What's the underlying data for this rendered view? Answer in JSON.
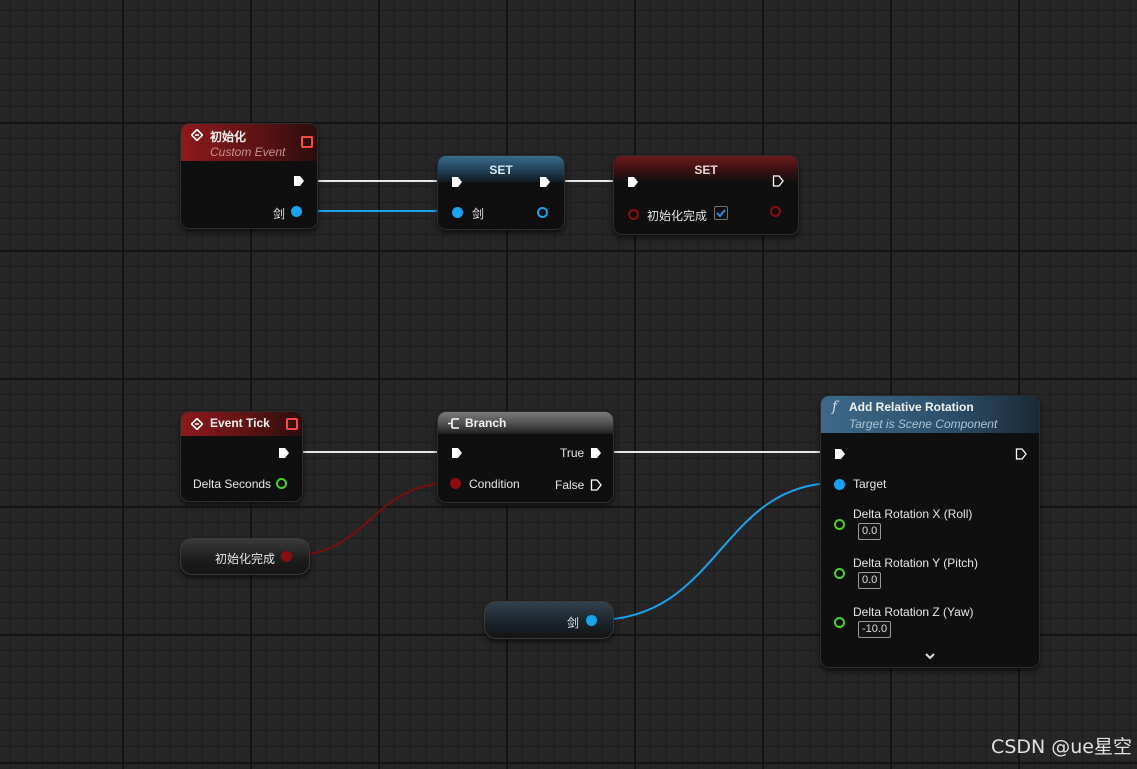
{
  "nodes": {
    "custom_event": {
      "title": "初始化",
      "subtitle": "Custom Event",
      "pin_label": "剑"
    },
    "set_sword": {
      "title": "SET",
      "pin_label": "剑"
    },
    "set_init": {
      "title": "SET",
      "pin_label": "初始化完成",
      "checked": true
    },
    "event_tick": {
      "title": "Event Tick",
      "pin_label": "Delta Seconds"
    },
    "branch": {
      "title": "Branch",
      "condition_label": "Condition",
      "true_label": "True",
      "false_label": "False"
    },
    "get_init": {
      "label": "初始化完成"
    },
    "get_sword": {
      "label": "剑"
    },
    "add_rotation": {
      "title": "Add Relative Rotation",
      "subtitle": "Target is Scene Component",
      "function_icon": "f",
      "target_label": "Target",
      "x_label": "Delta Rotation X (Roll)",
      "x_value": "0.0",
      "y_label": "Delta Rotation Y (Pitch)",
      "y_value": "0.0",
      "z_label": "Delta Rotation Z (Yaw)",
      "z_value": "-10.0",
      "expand_icon": "chevron-down-icon"
    }
  },
  "colors": {
    "exec_wire": "#ffffff",
    "object_pin": "#1aa3ef",
    "bool_pin": "#8c0d0d",
    "float_pin": "#4ccf2a",
    "event_header": "#8d1a1d"
  },
  "watermark": "CSDN @ue星空"
}
